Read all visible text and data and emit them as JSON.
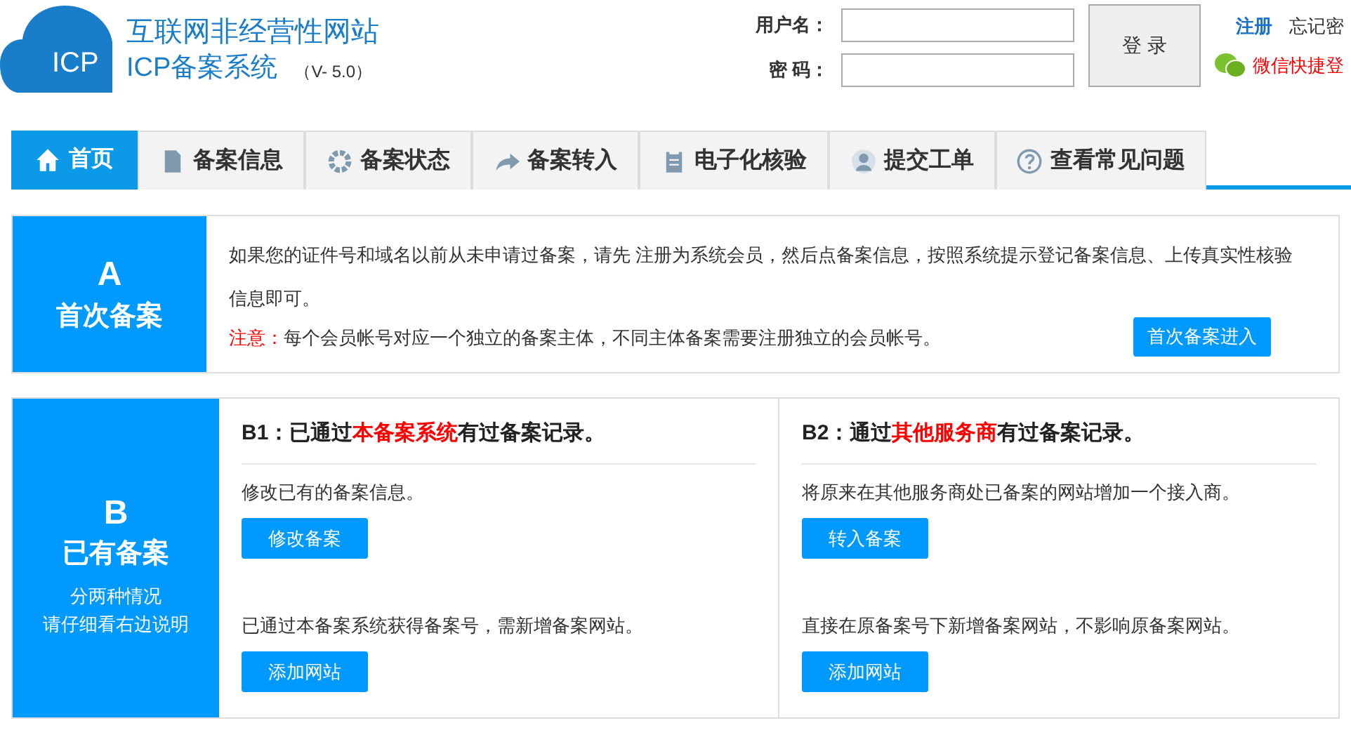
{
  "header": {
    "logo_text": "ICP",
    "title": "互联网非经营性网站",
    "subtitle": "ICP备案系统",
    "version": "（V- 5.0）"
  },
  "login": {
    "username_label": "用户名：",
    "password_label": "密 码：",
    "button": "登 录",
    "links": [
      {
        "text": "注册",
        "kind": "link"
      },
      {
        "text": "忘记密",
        "kind": "plain"
      }
    ],
    "wechat": "微信快捷登"
  },
  "nav": [
    {
      "label": "首页",
      "kind": "home",
      "selected": true
    },
    {
      "label": "备案信息",
      "kind": "document",
      "selected": false
    },
    {
      "label": "备案状态",
      "kind": "ring",
      "selected": false
    },
    {
      "label": "备案转入",
      "kind": "arrow",
      "selected": false
    },
    {
      "label": "电子化核验",
      "kind": "clipboard",
      "selected": false
    },
    {
      "label": "提交工单",
      "kind": "user",
      "selected": false
    },
    {
      "label": "查看常见问题",
      "kind": "question",
      "selected": false
    }
  ],
  "section_a": {
    "letter": "A",
    "title": "首次备案",
    "text": "如果您的证件号和域名以前从未申请过备案，请先 注册为系统会员，然后点备案信息，按照系统提示登记备案信息、上传真实性核验信息即可。",
    "note_label": "注意：",
    "note": "每个会员帐号对应一个独立的备案主体，不同主体备案需要注册独立的会员帐号。",
    "button": "首次备案进入"
  },
  "section_b": {
    "letter": "B",
    "title": "已有备案",
    "subtitle_lines": [
      "分两种情况",
      "请仔细看右边说明"
    ],
    "columns": [
      {
        "heading_prefix": "B1：已通过",
        "heading_highlight": "本备案系统",
        "heading_suffix": "有过备案记录。",
        "items": [
          {
            "text": "修改已有的备案信息。",
            "button": "修改备案"
          },
          {
            "text": "已通过本备案系统获得备案号，需新增备案网站。",
            "button": "添加网站"
          }
        ]
      },
      {
        "heading_prefix": "B2：通过",
        "heading_highlight": "其他服务商",
        "heading_suffix": "有过备案记录。",
        "items": [
          {
            "text": "将原来在其他服务商处已备案的网站增加一个接入商。",
            "button": "转入备案"
          },
          {
            "text": "直接在原备案号下新增备案网站，不影响原备案网站。",
            "button": "添加网站"
          }
        ]
      }
    ]
  }
}
